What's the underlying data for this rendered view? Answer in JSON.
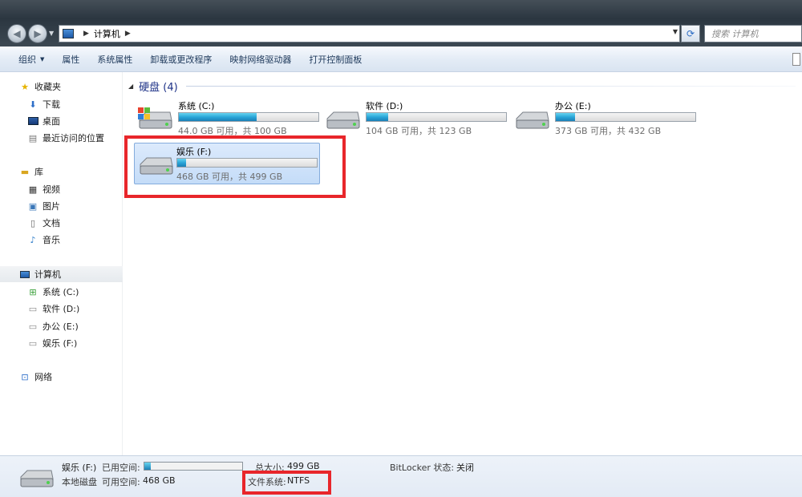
{
  "address": {
    "crumb": "计算机"
  },
  "search": {
    "placeholder": "搜索 计算机"
  },
  "toolbar": {
    "organize": "组织",
    "properties": "属性",
    "system_properties": "系统属性",
    "uninstall": "卸载或更改程序",
    "map_drive": "映射网络驱动器",
    "control_panel": "打开控制面板"
  },
  "sidebar": {
    "favorites": "收藏夹",
    "downloads": "下载",
    "desktop": "桌面",
    "recent": "最近访问的位置",
    "libraries": "库",
    "videos": "视频",
    "pictures": "图片",
    "documents": "文档",
    "music": "音乐",
    "computer": "计算机",
    "drive_c": "系统 (C:)",
    "drive_d": "软件 (D:)",
    "drive_e": "办公 (E:)",
    "drive_f": "娱乐 (F:)",
    "network": "网络"
  },
  "group": {
    "title": "硬盘 (4)"
  },
  "drives": [
    {
      "name": "系统 (C:)",
      "info": "44.0 GB 可用，共 100 GB",
      "used_fraction": 0.56
    },
    {
      "name": "软件 (D:)",
      "info": "104 GB 可用，共 123 GB",
      "used_fraction": 0.155
    },
    {
      "name": "办公 (E:)",
      "info": "373 GB 可用，共 432 GB",
      "used_fraction": 0.137
    },
    {
      "name": "娱乐 (F:)",
      "info": "468 GB 可用，共 499 GB",
      "used_fraction": 0.062
    }
  ],
  "details": {
    "name": "娱乐 (F:)",
    "used_label": "已用空间:",
    "type": "本地磁盘",
    "free_label": "可用空间:",
    "free_value": "468 GB",
    "total_label": "总大小:",
    "total_value": "499 GB",
    "fs_label": "文件系统:",
    "fs_value": "NTFS",
    "bitlocker_label": "BitLocker 状态:",
    "bitlocker_value": "关闭",
    "used_fraction": 0.062
  },
  "colors": {
    "highlight_box": "#e8262b",
    "bar_fill": "#2aa6d8"
  }
}
